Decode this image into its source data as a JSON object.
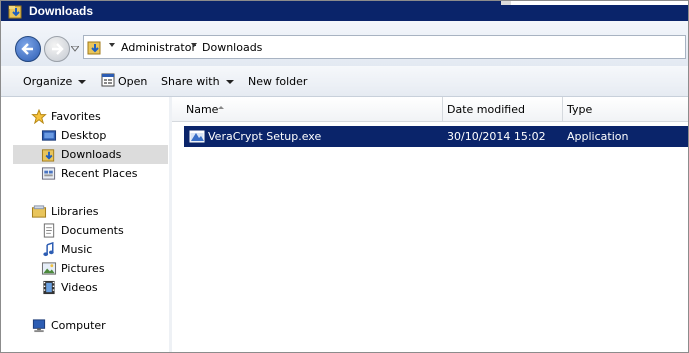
{
  "window": {
    "title": "Downloads"
  },
  "address": {
    "crumbs": [
      "Administrator",
      "Downloads"
    ]
  },
  "commands": {
    "organize": "Organize",
    "open": "Open",
    "share_with": "Share with",
    "new_folder": "New folder"
  },
  "nav": {
    "favorites": {
      "label": "Favorites",
      "icon": "star-icon"
    },
    "items": [
      {
        "label": "Desktop",
        "icon": "desktop-icon"
      },
      {
        "label": "Downloads",
        "icon": "downloads-folder-icon",
        "selected": true
      },
      {
        "label": "Recent Places",
        "icon": "recent-places-icon"
      }
    ],
    "libraries": {
      "label": "Libraries",
      "icon": "libraries-icon"
    },
    "library_items": [
      {
        "label": "Documents",
        "icon": "documents-icon"
      },
      {
        "label": "Music",
        "icon": "music-icon"
      },
      {
        "label": "Pictures",
        "icon": "pictures-icon"
      },
      {
        "label": "Videos",
        "icon": "videos-icon"
      }
    ],
    "computer": {
      "label": "Computer",
      "icon": "computer-icon"
    }
  },
  "columns": [
    "Name",
    "Date modified",
    "Type"
  ],
  "files": [
    {
      "name": "VeraCrypt Setup.exe",
      "date_modified": "30/10/2014 15:02",
      "type": "Application",
      "icon": "installer-icon",
      "selected": true
    }
  ],
  "colors": {
    "titlebar": "#0a246a",
    "selection": "#0a246a",
    "nav_selection": "#dcdcdc"
  }
}
